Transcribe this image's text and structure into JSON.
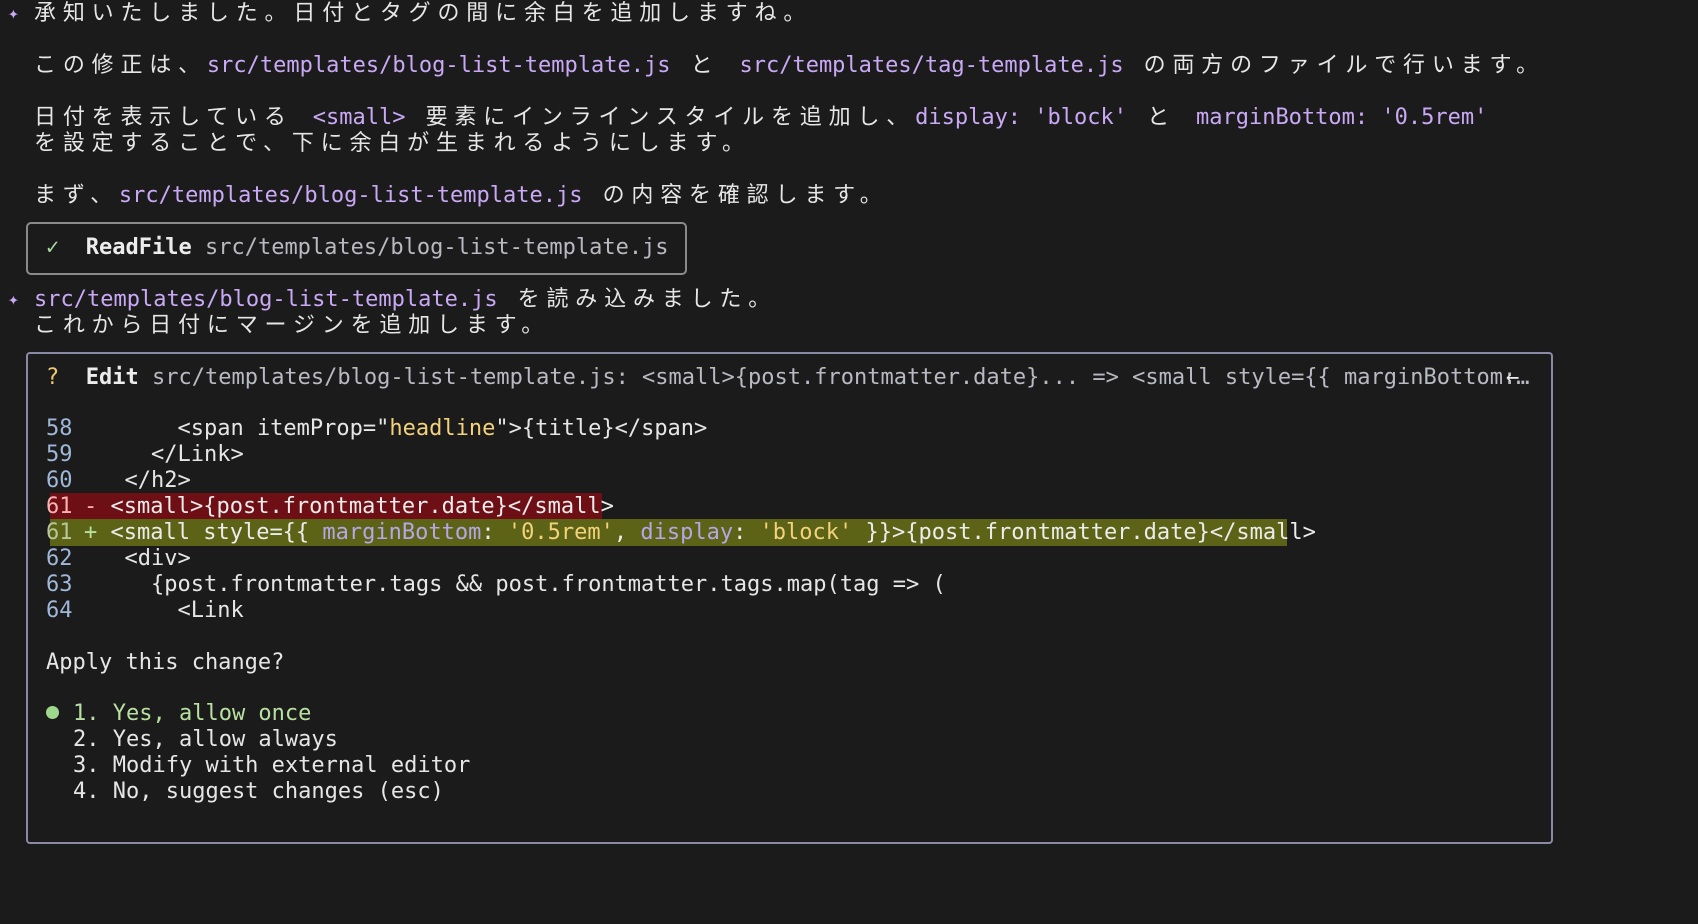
{
  "messages": {
    "m1": "承知いたしました。日付とタグの間に余白を追加しますね。",
    "m2_a": "この修正は、",
    "m2_file1": "src/templates/blog-list-template.js",
    "m2_b": " と ",
    "m2_file2": "src/templates/tag-template.js",
    "m2_c": " の両方のファイルで行います。",
    "m3_a": "日付を表示している ",
    "m3_code1": "<small>",
    "m3_b": " 要素にインラインスタイルを追加し、",
    "m3_code2": "display: 'block'",
    "m3_c": " と ",
    "m3_code3": "marginBottom: '0.5rem'",
    "m3_d": "を設定することで、下に余白が生まれるようにします。",
    "m4_a": "まず、",
    "m4_file": "src/templates/blog-list-template.js",
    "m4_b": " の内容を確認します。",
    "m5_file": "src/templates/blog-list-template.js",
    "m5_a": " を読み込みました。",
    "m5_b": "これから日付にマージンを追加します。"
  },
  "readfile": {
    "status_icon": "✓",
    "tool": "ReadFile",
    "path": "src/templates/blog-list-template.js"
  },
  "edit": {
    "status_icon": "?",
    "tool": "Edit",
    "summary": "src/templates/blog-list-template.js: <small>{post.frontmatter.date}... => <small style={{ marginBottom:…",
    "arrow": "←",
    "diff": {
      "l58": {
        "num": "58",
        "text": "      <span itemProp=\"",
        "str": "headline",
        "text2": "\">{title}</span>"
      },
      "l59": {
        "num": "59",
        "text": "    </Link>"
      },
      "l60": {
        "num": "60",
        "text": "  </h2>"
      },
      "l61del": {
        "num": "61",
        "sign": "-",
        "text": "<small>{post.frontmatter.date}</small>"
      },
      "l61add": {
        "num": "61",
        "sign": "+",
        "t1": "<small style={{ ",
        "k1": "marginBottom",
        "t2": ": ",
        "s1": "'0.5rem'",
        "t3": ", ",
        "k2": "display",
        "t4": ": ",
        "s2": "'block'",
        "t5": " }}>{post.frontmatter.date}</small>"
      },
      "l62": {
        "num": "62",
        "text": "  <div>"
      },
      "l63": {
        "num": "63",
        "text": "    {post.frontmatter.tags && post.frontmatter.tags.map(tag => ("
      },
      "l64": {
        "num": "64",
        "text": "      <Link"
      }
    },
    "question": "Apply this change?",
    "options": [
      "1. Yes, allow once",
      "2. Yes, allow always",
      "3. Modify with external editor",
      "4. No, suggest changes (esc)"
    ]
  },
  "colors": {
    "background": "#1b1b1c",
    "accent_purple": "#c9a9f5",
    "diff_removed_bg": "#6e0f15",
    "diff_added_bg": "#5d6316",
    "selected_green": "#9ed88c"
  }
}
